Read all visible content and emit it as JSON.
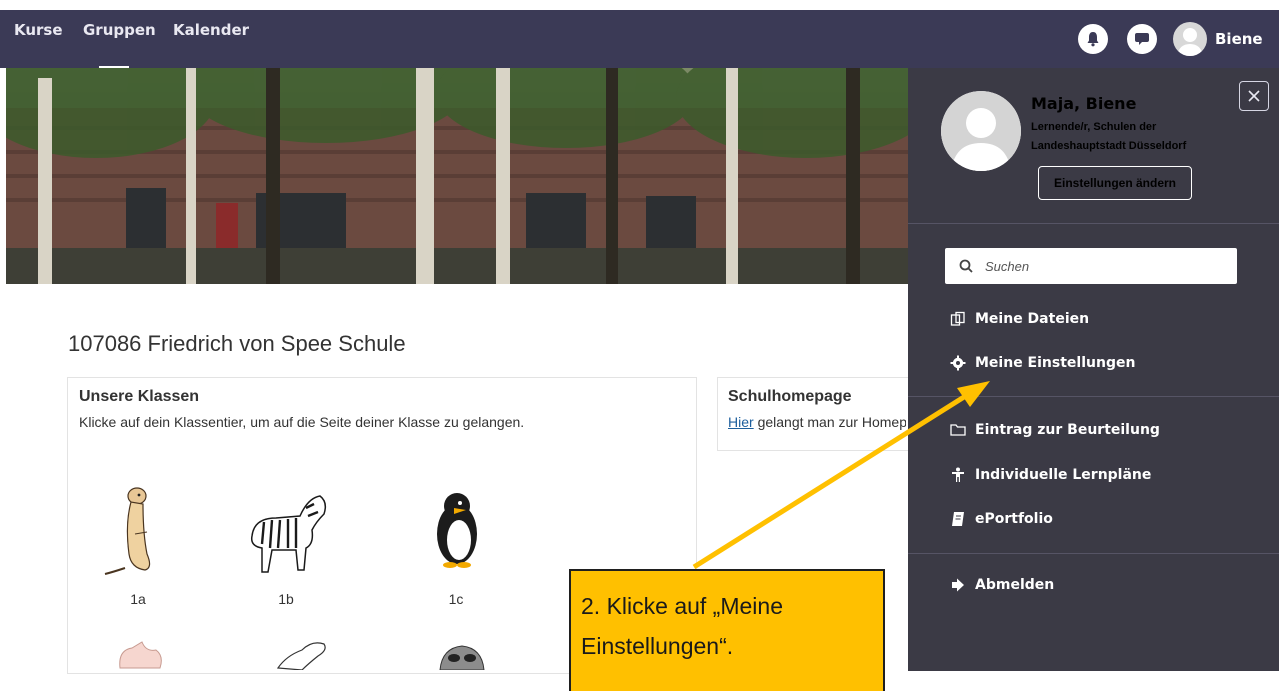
{
  "nav": {
    "items": [
      "Kurse",
      "Gruppen",
      "Kalender"
    ],
    "active": "Gruppen",
    "user_name": "Biene",
    "notifications_icon": "bell-icon",
    "messages_icon": "chat-icon"
  },
  "page": {
    "title": "107086 Friedrich von Spee Schule"
  },
  "classes_card": {
    "heading": "Unsere Klassen",
    "text": "Klicke auf dein Klassentier, um auf die Seite deiner Klasse zu gelangen.",
    "classes": [
      {
        "label": "1a",
        "animal": "meerkat"
      },
      {
        "label": "1b",
        "animal": "zebra"
      },
      {
        "label": "1c",
        "animal": "penguin"
      }
    ]
  },
  "homepage_card": {
    "heading": "Schulhomepage",
    "link_text": "Hier",
    "text": "gelangt man zur Homep"
  },
  "drawer": {
    "name": "Maja, Biene",
    "role": "Lernende/r, Schulen der Landeshauptstadt Düsseldorf",
    "settings_button": "Einstellungen ändern",
    "search_placeholder": "Suchen",
    "menu": [
      {
        "label": "Meine Dateien",
        "icon": "files-icon"
      },
      {
        "label": "Meine Einstellungen",
        "icon": "gear-icon"
      },
      {
        "label": "Eintrag zur Beurteilung",
        "icon": "folder-icon"
      },
      {
        "label": "Individuelle Lernpläne",
        "icon": "person-icon"
      },
      {
        "label": "ePortfolio",
        "icon": "book-icon"
      },
      {
        "label": "Abmelden",
        "icon": "logout-icon"
      }
    ]
  },
  "callout": {
    "line1": "2. Klicke auf „Meine",
    "line2": "Einstellungen“."
  },
  "colors": {
    "topbar": "#3b3a56",
    "drawer": "#3b3a45",
    "callout": "#ffc000",
    "arrow": "#ffc000"
  }
}
